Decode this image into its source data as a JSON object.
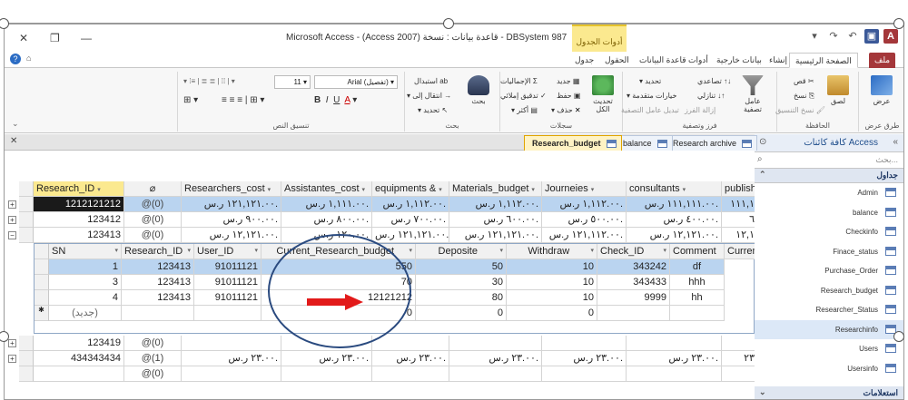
{
  "window": {
    "title": "Microsoft Access - (Access 2007) قاعدة بيانات : نسخة - DBSystem 987",
    "contextual_group": "أدوات الجدول",
    "qat_icons": [
      "access-logo-icon",
      "save-icon",
      "undo-icon",
      "redo-icon",
      "customize-icon"
    ],
    "controls": {
      "close": "✕",
      "restore": "❐",
      "minimize": "—"
    }
  },
  "ribbon_tabs": [
    "ملف",
    "الصفحة الرئيسية",
    "إنشاء",
    "بيانات خارجية",
    "أدوات قاعدة البيانات",
    "الحقول",
    "جدول"
  ],
  "ribbon": {
    "groups": [
      {
        "label": "طرق عرض",
        "buttons": [
          "عرض"
        ]
      },
      {
        "label": "الحافظة",
        "buttons": [
          "لصق",
          "قص",
          "نسخ",
          "نسخ التنسيق"
        ]
      },
      {
        "label": "فرز وتصفية",
        "buttons": [
          "عامل تصفية",
          "تصاعدي",
          "تنازلي",
          "إزالة الفرز",
          "تحديد",
          "خيارات متقدمة",
          "تبديل عامل التصفية"
        ]
      },
      {
        "label": "سجلات",
        "buttons": [
          "تحديث الكل",
          "جديد",
          "حفظ",
          "حذف",
          "الإجماليات",
          "تدقيق إملائي",
          "أكثر"
        ]
      },
      {
        "label": "بحث",
        "buttons": [
          "بحث",
          "استبدال",
          "انتقال إلى",
          "تحديد"
        ]
      },
      {
        "label": "تنسيق النص",
        "buttons": [
          "Arial (تفصيل)",
          "11"
        ]
      }
    ]
  },
  "nav_pane": {
    "title": "كافة كائنات Access",
    "search_placeholder": "بحث...",
    "section_tables": "جداول",
    "tables": [
      "Admin",
      "balance",
      "Checkinfo",
      "Finace_status",
      "Purchase_Order",
      "Research_budget",
      "Researcher_Status",
      "Researchinfo",
      "Users",
      "Usersinfo"
    ],
    "selected": "Researchinfo",
    "section_queries": "استعلامات"
  },
  "doc_tabs": [
    "Research archive",
    "balance",
    "Research_budget"
  ],
  "active_doc_tab": "Research_budget",
  "main_table": {
    "columns": [
      "Research_ID",
      "",
      "Researchers_cost",
      "Assistantes_cost",
      "equipments &",
      "Materials_budget",
      "Journeies",
      "consultants",
      "publishin"
    ],
    "rows": [
      {
        "id": "1212121212",
        "attach": "@(0)",
        "vals": [
          "١٢١,١٢١.٠٠ ر.س.",
          "١,١١١.٠٠ ر.س.",
          "١,١١٢.٠٠ ر.س.",
          "١,١١٢.٠٠ ر.س.",
          "١,١١٢.٠٠ ر.س.",
          "١١١,١١١.٠٠ ر.س.",
          "١١١,١"
        ],
        "sel": true,
        "exp": "+"
      },
      {
        "id": "123412",
        "attach": "@(0)",
        "vals": [
          "٩٠٠.٠٠ ر.س.",
          "٨٠٠.٠٠ ر.س.",
          "٧٠٠.٠٠ ر.س.",
          "٦٠٠.٠٠ ر.س.",
          "٥٠٠.٠٠ ر.س.",
          "٤٠٠.٠٠ ر.س.",
          "٦"
        ],
        "sel": false,
        "exp": "+"
      },
      {
        "id": "123413",
        "attach": "@(0)",
        "vals": [
          "١٢,١٢١.٠٠ ر.س.",
          "١٢٠.٠٠ ر.س.",
          "١٢١,١٢١.٠٠ ر.س.",
          "١٢١,١٢١.٠٠ ر.س.",
          "١٢١,١١٢.٠٠ ر.س.",
          "١٢,١٢١.٠٠ ر.س.",
          "١٢,١"
        ],
        "sel": false,
        "exp": "−"
      }
    ],
    "rows_after": [
      {
        "id": "123419",
        "attach": "@(0)",
        "vals": [
          "",
          "",
          "",
          "",
          "",
          "",
          ""
        ],
        "exp": "+"
      },
      {
        "id": "434343434",
        "attach": "@(1)",
        "vals": [
          "٢٣.٠٠ ر.س.",
          "٢٣.٠٠ ر.س.",
          "٢٣.٠٠ ر.س.",
          "٢٣.٠٠ ر.س.",
          "٢٣.٠٠ ر.س.",
          "٢٣.٠٠ ر.س.",
          "٢٣"
        ],
        "exp": "+"
      },
      {
        "id": "",
        "attach": "@(0)",
        "vals": [
          "",
          "",
          "",
          "",
          "",
          "",
          ""
        ],
        "exp": ""
      }
    ]
  },
  "sub_table": {
    "columns": [
      "SN",
      "Research_ID",
      "User_ID",
      "Current_Research_budget",
      "Deposite",
      "Withdraw",
      "Check_ID",
      "Comment",
      "Current"
    ],
    "rows": [
      {
        "vals": [
          "1",
          "123413",
          "91011121",
          "550",
          "50",
          "10",
          "343242",
          "df"
        ],
        "sel": true
      },
      {
        "vals": [
          "3",
          "123413",
          "91011121",
          "70",
          "30",
          "10",
          "343433",
          "hhh"
        ],
        "sel": false
      },
      {
        "vals": [
          "4",
          "123413",
          "91011121",
          "12121212",
          "80",
          "10",
          "9999",
          "hh"
        ],
        "sel": false
      },
      {
        "vals": [
          "(جديد)",
          "",
          "",
          "0",
          "0",
          "0",
          "",
          ""
        ],
        "sel": false,
        "new": true
      }
    ]
  }
}
